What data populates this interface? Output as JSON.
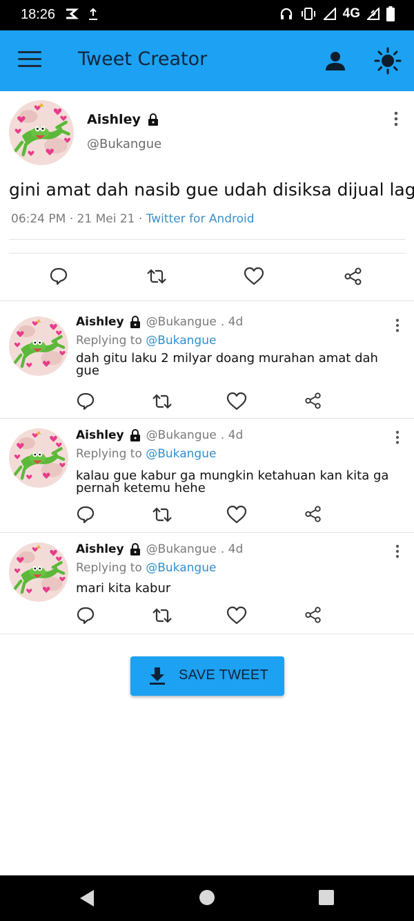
{
  "status_bar": {
    "time": "18:26",
    "network": "4G",
    "icons": [
      "link-icon",
      "upload-icon",
      "headphones-icon",
      "vibrate-icon",
      "signal-icon",
      "data-icon",
      "battery-icon"
    ]
  },
  "app_bar": {
    "title": "Tweet Creator",
    "icons": [
      "menu-icon",
      "profile-icon",
      "theme-icon"
    ],
    "color": "#1da1f2"
  },
  "main_tweet": {
    "name": "Aishley",
    "handle": "@Bukangue",
    "text": "gini amat dah nasib gue udah disiksa dijual lagi",
    "time": "06:24 PM",
    "date": "21 Mei 21",
    "client": "Twitter for Android",
    "sep": "·"
  },
  "replies": [
    {
      "name": "Aishley",
      "handle": "@Bukangue",
      "age": ". 4d",
      "replying_label": "Replying to",
      "mention": "@Bukangue",
      "text": "dah gitu laku 2 milyar doang murahan amat dah gue"
    },
    {
      "name": "Aishley",
      "handle": "@Bukangue",
      "age": ". 4d",
      "replying_label": "Replying to",
      "mention": "@Bukangue",
      "text": "kalau gue kabur ga mungkin ketahuan kan kita ga pernah ketemu hehe"
    },
    {
      "name": "Aishley",
      "handle": "@Bukangue",
      "age": ". 4d",
      "replying_label": "Replying to",
      "mention": "@Bukangue",
      "text": "mari kita kabur"
    }
  ],
  "save_button": {
    "label": "SAVE TWEET",
    "icon": "download-icon"
  },
  "nav_bar": {
    "icons": [
      "back-icon",
      "home-icon",
      "recents-icon"
    ]
  }
}
